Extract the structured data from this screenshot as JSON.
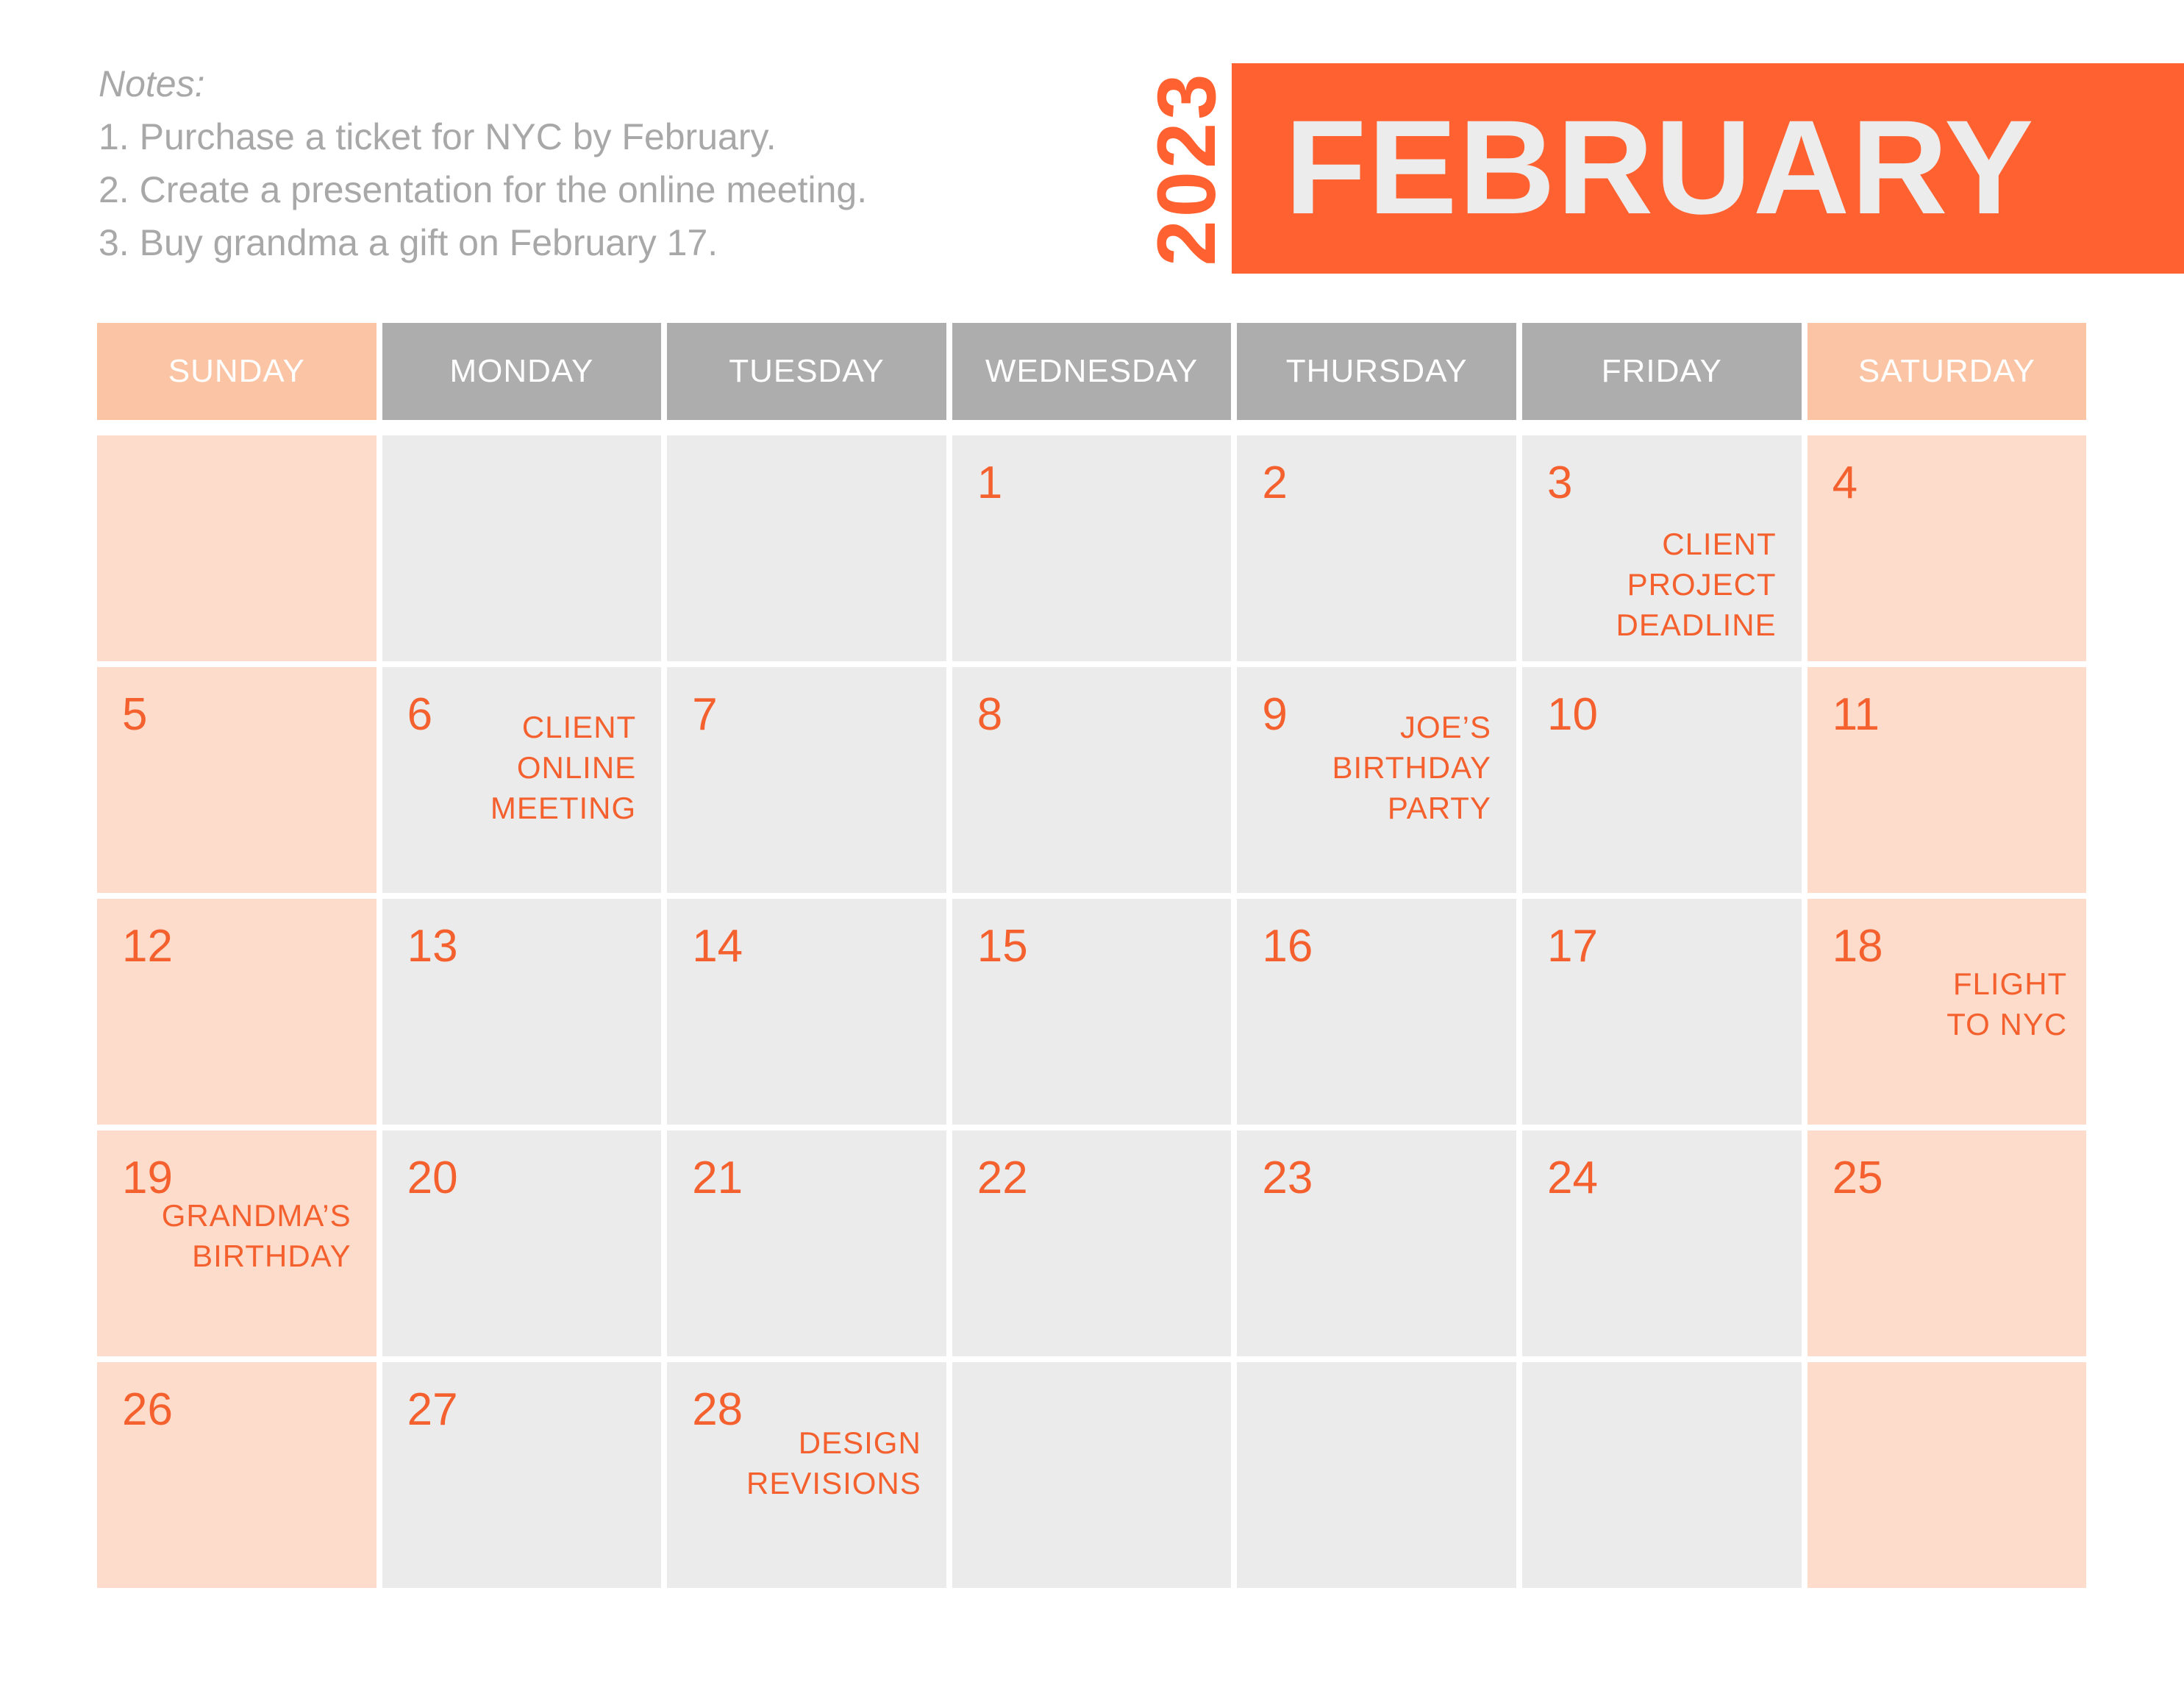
{
  "notes": {
    "title": "Notes:",
    "items": [
      "1. Purchase a ticket for NYC by February.",
      "2. Create a presentation for the online meeting.",
      "3. Buy grandma a gift on February 17."
    ]
  },
  "header": {
    "year": "2023",
    "month": "FEBRUARY"
  },
  "colors": {
    "accent": "#ff6130",
    "weekday_header": "#adadad",
    "weekend_header": "#fbc4a4",
    "weekday_cell": "#ebebeb",
    "weekend_cell": "#fddccb",
    "notes_text": "#a8a8a8"
  },
  "weekdays": [
    "SUNDAY",
    "MONDAY",
    "TUESDAY",
    "WEDNESDAY",
    "THURSDAY",
    "FRIDAY",
    "SATURDAY"
  ],
  "weeks": [
    [
      {
        "day": ""
      },
      {
        "day": ""
      },
      {
        "day": ""
      },
      {
        "day": "1"
      },
      {
        "day": "2"
      },
      {
        "day": "3",
        "event": "CLIENT\nPROJECT\nDEADLINE"
      },
      {
        "day": "4"
      }
    ],
    [
      {
        "day": "5"
      },
      {
        "day": "6",
        "event": "CLIENT\nONLINE\nMEETING"
      },
      {
        "day": "7"
      },
      {
        "day": "8"
      },
      {
        "day": "9",
        "event": "JOE’S\nBIRTHDAY\nPARTY"
      },
      {
        "day": "10"
      },
      {
        "day": "11"
      }
    ],
    [
      {
        "day": "12"
      },
      {
        "day": "13"
      },
      {
        "day": "14"
      },
      {
        "day": "15"
      },
      {
        "day": "16"
      },
      {
        "day": "17"
      },
      {
        "day": "18",
        "event": "FLIGHT\nTO NYC"
      }
    ],
    [
      {
        "day": "19",
        "event": "GRANDMA’S\nBIRTHDAY"
      },
      {
        "day": "20"
      },
      {
        "day": "21"
      },
      {
        "day": "22"
      },
      {
        "day": "23"
      },
      {
        "day": "24"
      },
      {
        "day": "25"
      }
    ],
    [
      {
        "day": "26"
      },
      {
        "day": "27"
      },
      {
        "day": "28",
        "event": "DESIGN\nREVISIONS"
      },
      {
        "day": ""
      },
      {
        "day": ""
      },
      {
        "day": ""
      },
      {
        "day": ""
      }
    ]
  ]
}
